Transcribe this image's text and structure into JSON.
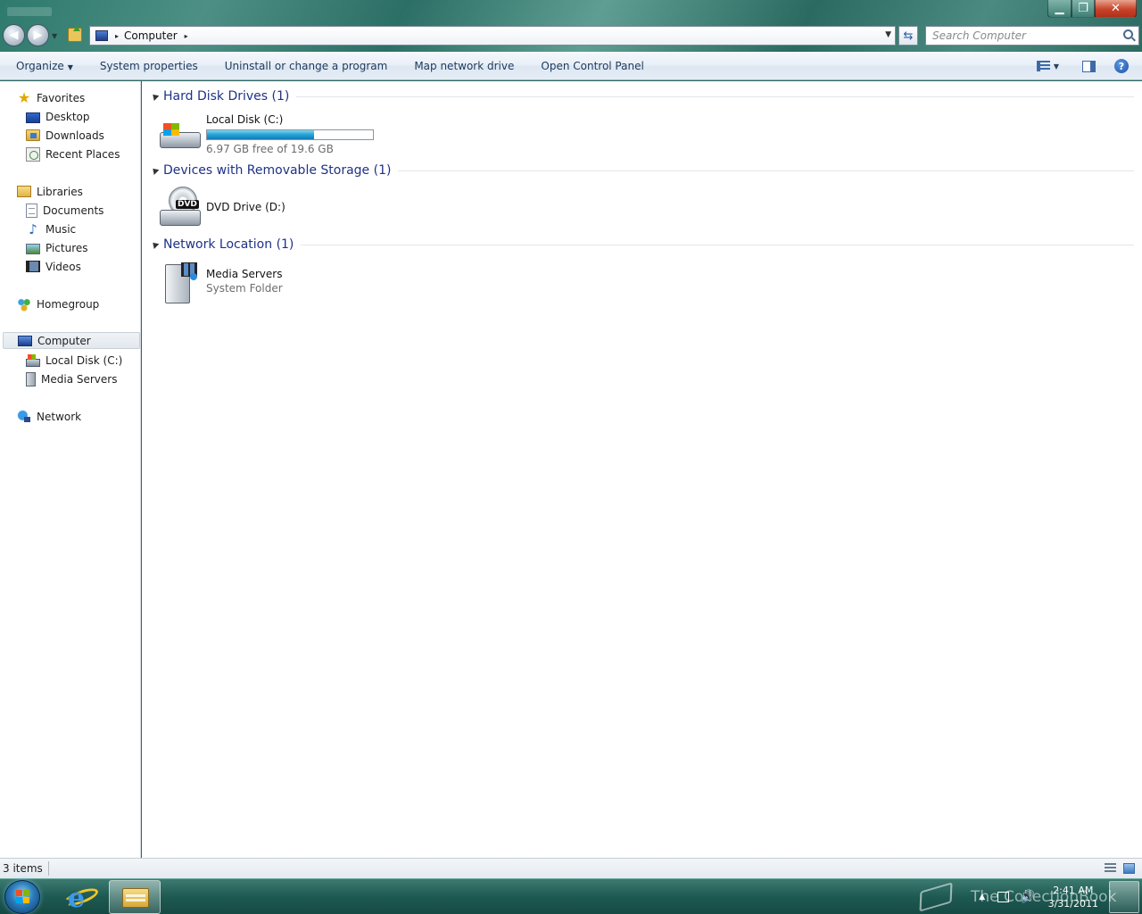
{
  "window": {
    "caption_buttons": {
      "minimize": "▁",
      "maximize": "❐",
      "close": "✕"
    }
  },
  "address_bar": {
    "location": "Computer",
    "separator_glyph": "▸"
  },
  "search": {
    "placeholder": "Search Computer"
  },
  "command_bar": {
    "organize": "Organize",
    "system_properties": "System properties",
    "uninstall": "Uninstall or change a program",
    "map_drive": "Map network drive",
    "control_panel": "Open Control Panel",
    "help_glyph": "?"
  },
  "nav": {
    "favorites": "Favorites",
    "desktop": "Desktop",
    "downloads": "Downloads",
    "recent_places": "Recent Places",
    "libraries": "Libraries",
    "documents": "Documents",
    "music": "Music",
    "pictures": "Pictures",
    "videos": "Videos",
    "homegroup": "Homegroup",
    "computer": "Computer",
    "local_disk": "Local Disk (C:)",
    "media_servers": "Media Servers",
    "network": "Network",
    "star_glyph": "★",
    "note_glyph": "♪"
  },
  "groups": {
    "hdd": {
      "title": "Hard Disk Drives (1)",
      "item_name": "Local Disk (C:)",
      "free_text": "6.97 GB free of 19.6 GB",
      "used_fraction": 0.644
    },
    "removable": {
      "title": "Devices with Removable Storage (1)",
      "item_name": "DVD Drive (D:)",
      "icon_label": "DVD"
    },
    "network": {
      "title": "Network Location (1)",
      "item_name": "Media Servers",
      "item_type": "System Folder"
    }
  },
  "status": {
    "item_count": "3 items"
  },
  "taskbar": {
    "time": "2:41 AM",
    "date": "3/31/2011",
    "watermark": "The CollectionBook",
    "tray_up": "▲",
    "volume_glyph": "🔊"
  },
  "colors": {
    "group_header": "#1e3287",
    "capacity_fill": "#26a6d8",
    "taskbar": "#1e5a52"
  }
}
